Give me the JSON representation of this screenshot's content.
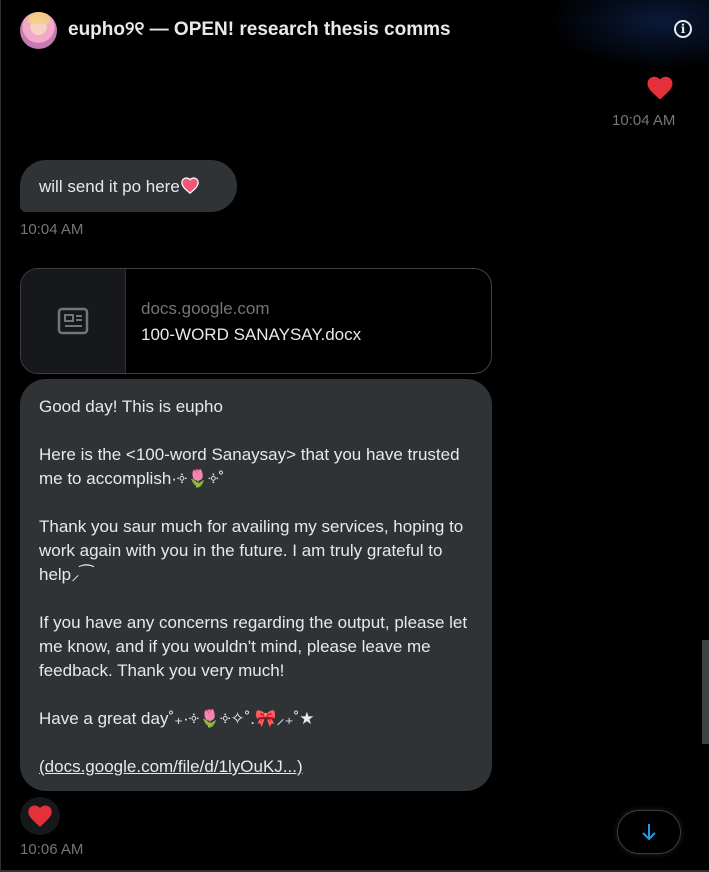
{
  "header": {
    "title": "eupho୨୧ — OPEN! research thesis comms",
    "info_icon_label": "i"
  },
  "messages": [
    {
      "side": "right",
      "type": "reaction",
      "reaction": "red-heart",
      "timestamp": "10:04 AM"
    },
    {
      "side": "left",
      "type": "text",
      "text": "will send it po here",
      "emoji": "pink-heart",
      "timestamp": "10:04 AM"
    },
    {
      "side": "left",
      "type": "link-card",
      "card": {
        "domain": "docs.google.com",
        "title": "100-WORD SANAYSAY.docx",
        "icon": "article-icon"
      },
      "paragraphs": [
        "Good day! This is eupho",
        "Here is the <100-word Sanaysay> that you have trusted me to accomplish·༓🌷༓˚",
        "Thank you saur much for availing my services, hoping to work again with you in the future. I am truly grateful to help⸝⁀",
        "If you have any concerns regarding the output, please let me know, and if you wouldn't mind, please leave me feedback. Thank you very much!",
        "Have a great day˚₊·༓🌷༓✧˚.🎀⸝₊˚★",
        "(docs.google.com/file/d/1lyOuKJ...)"
      ],
      "reaction": "red-heart",
      "timestamp": "10:06 AM"
    }
  ],
  "colors": {
    "background": "#000000",
    "bubble": "#2f3336",
    "text": "#e7e9ea",
    "muted": "#71767b",
    "heart": "#f91880",
    "accent": "#1d9bf0"
  },
  "controls": {
    "scroll_down_icon": "arrow-down-icon"
  }
}
